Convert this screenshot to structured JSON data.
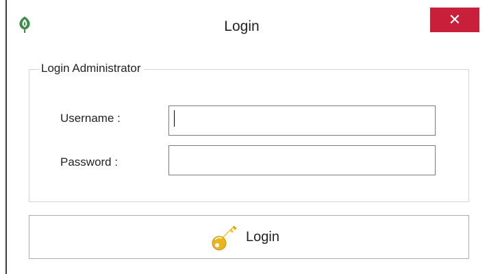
{
  "window": {
    "title": "Login",
    "close_label": "✕",
    "app_icon": "leaf-logo-icon"
  },
  "group": {
    "legend": "Login Administrator"
  },
  "fields": {
    "username_label": "Username :",
    "username_value": "",
    "password_label": "Password :",
    "password_value": ""
  },
  "login_button": {
    "label": "Login",
    "icon": "key-icon"
  },
  "colors": {
    "close_button_bg": "#c8203a",
    "logo_green": "#2e8b3e",
    "key_gold": "#e8b020"
  }
}
